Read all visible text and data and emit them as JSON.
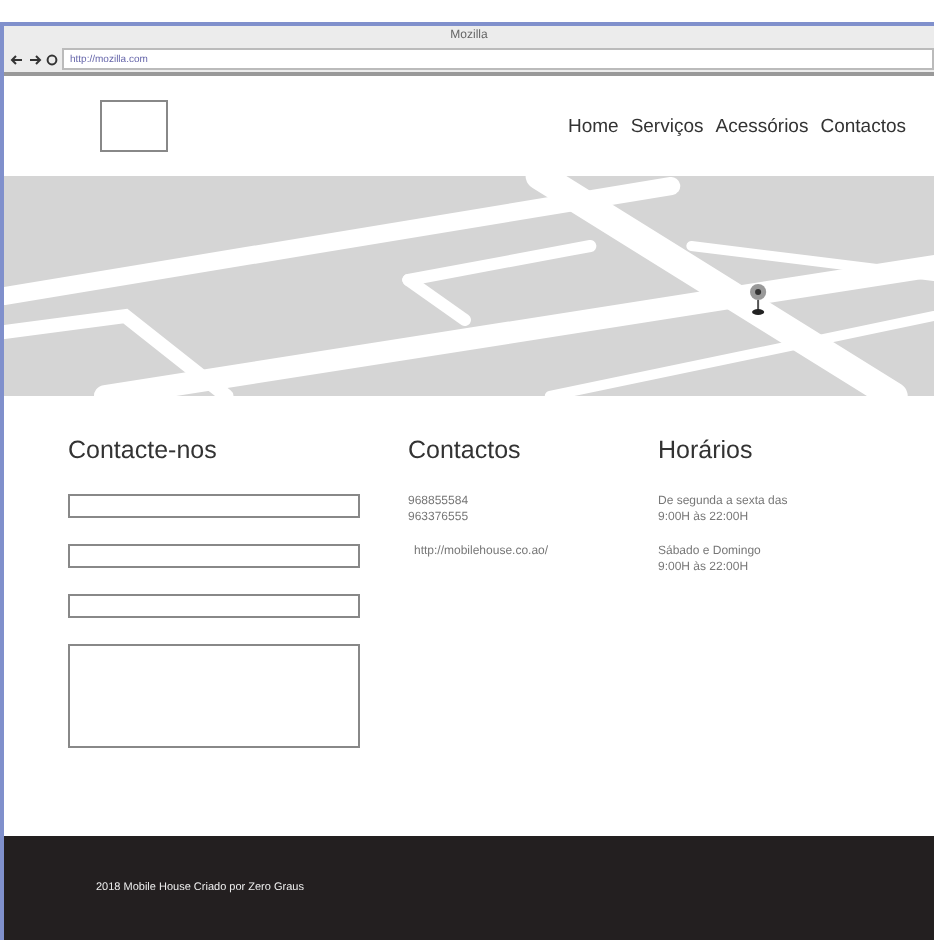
{
  "window": {
    "title": "Mozilla"
  },
  "browser": {
    "url": "http://mozilla.com"
  },
  "nav": {
    "items": [
      {
        "label": "Home"
      },
      {
        "label": "Serviços"
      },
      {
        "label": "Acessórios"
      },
      {
        "label": "Contactos"
      }
    ]
  },
  "contact_form": {
    "title": "Contacte-nos",
    "fields": [
      {
        "kind": "line"
      },
      {
        "kind": "line"
      },
      {
        "kind": "line"
      },
      {
        "kind": "area"
      }
    ]
  },
  "contacts": {
    "title": "Contactos",
    "phones": [
      "968855584",
      "963376555"
    ],
    "website": "http://mobilehouse.co.ao/"
  },
  "hours": {
    "title": "Horários",
    "entries": [
      {
        "days": "De segunda a sexta das",
        "time": "9:00H às 22:00H"
      },
      {
        "days": "Sábado e Domingo",
        "time": "9:00H às 22:00H"
      }
    ]
  },
  "footer": {
    "text": "2018 Mobile House Criado por Zero Graus"
  }
}
